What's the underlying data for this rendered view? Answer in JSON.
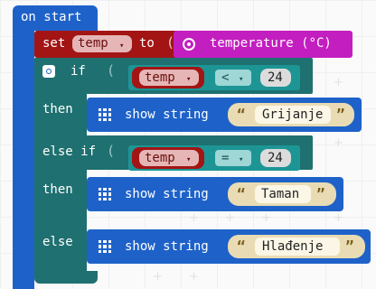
{
  "event": {
    "label": "on start"
  },
  "set_block": {
    "label": "set",
    "variable": "temp",
    "to_label": "to",
    "sensor_label": "temperature (°C)"
  },
  "if_block": {
    "if_label": "if",
    "then_label": "then",
    "else_if_label": "else if",
    "else_label": "else",
    "conditions": [
      {
        "variable": "temp",
        "operator": "<",
        "value": "24"
      },
      {
        "variable": "temp",
        "operator": "=",
        "value": "24"
      }
    ],
    "actions": [
      {
        "label": "show string",
        "value": "Grijanje"
      },
      {
        "label": "show string",
        "value": "Taman"
      },
      {
        "label": "show string",
        "value": "Hlađenje"
      }
    ]
  },
  "dropdown_caret": "▾",
  "colors": {
    "event_blue": "#1e62c9",
    "variables_red": "#a31515",
    "logic_teal": "#1f7070",
    "input_magenta": "#c31ec0",
    "text_tan": "#e9dcb4"
  }
}
